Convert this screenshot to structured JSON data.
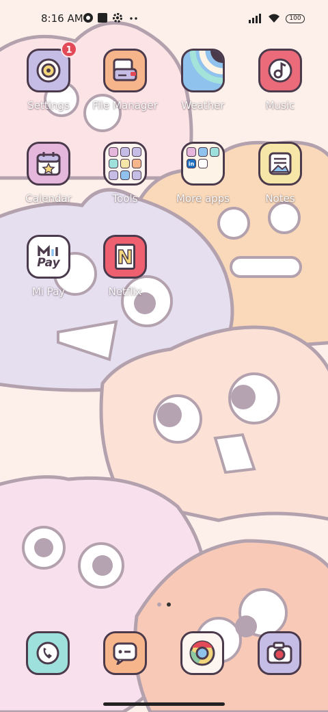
{
  "status_bar": {
    "time": "8:16 AM",
    "battery": "100",
    "icons": [
      "app-notification-icon",
      "square-notification-icon",
      "gear-icon",
      "more-dots-icon",
      "signal-icon",
      "wifi-icon",
      "battery-icon"
    ]
  },
  "apps": [
    {
      "label": "Settings",
      "icon": "settings-icon",
      "bg": "#c5bde6",
      "badge": "1"
    },
    {
      "label": "File Manager",
      "icon": "file-manager-icon",
      "bg": "#f7b58c"
    },
    {
      "label": "Weather",
      "icon": "weather-icon",
      "bg": "#8fc2ec"
    },
    {
      "label": "Music",
      "icon": "music-icon",
      "bg": "#ec6b7a"
    },
    {
      "label": "Calendar",
      "icon": "calendar-icon",
      "bg": "#e6b7dc"
    },
    {
      "label": "Tools",
      "icon": "folder-icon",
      "bg": "#fdf6f0"
    },
    {
      "label": "More apps",
      "icon": "folder-icon",
      "bg": "#fdf3e6"
    },
    {
      "label": "Notes",
      "icon": "notes-icon",
      "bg": "#f6e7a8"
    },
    {
      "label": "Mi Pay",
      "icon": "mi-pay-icon",
      "bg": "#ffffff",
      "text": "Pay"
    },
    {
      "label": "Netflix",
      "icon": "netflix-icon",
      "bg": "#ee5f6f",
      "text": "N"
    }
  ],
  "folders": {
    "more_apps_mini": [
      "in"
    ]
  },
  "dock": [
    {
      "name": "phone",
      "icon": "phone-icon",
      "bg": "#9ee0db"
    },
    {
      "name": "messages",
      "icon": "messages-icon",
      "bg": "#f7b58c"
    },
    {
      "name": "chrome",
      "icon": "chrome-icon",
      "bg": "#fdf6f0"
    },
    {
      "name": "camera",
      "icon": "camera-icon",
      "bg": "#c5bde6"
    }
  ],
  "pager": {
    "pages": 2,
    "active": 2
  },
  "colors": {
    "outline": "#4b3a4c",
    "badge": "#e24a58",
    "pager_inactive": "#b6a4b0",
    "pager_active": "#333333"
  }
}
